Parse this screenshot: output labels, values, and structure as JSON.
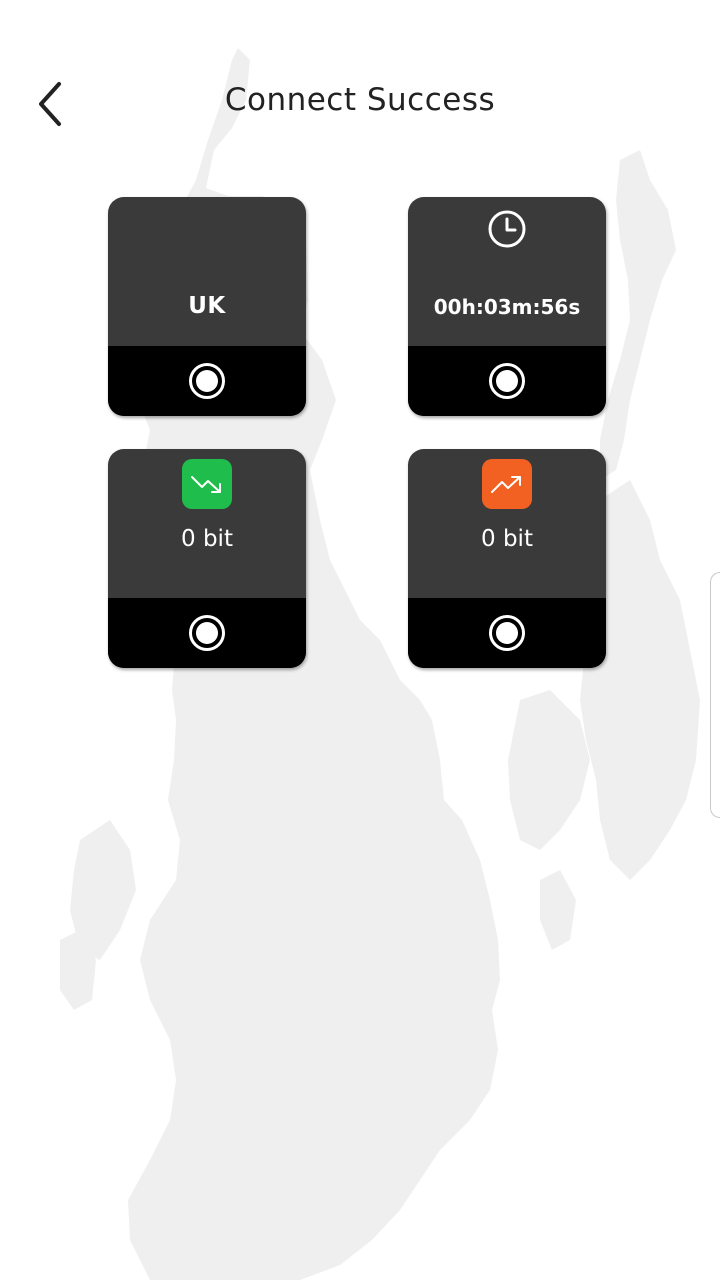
{
  "header": {
    "title": "Connect Success",
    "back_icon": "chevron-left-icon"
  },
  "cards": {
    "location": {
      "label": "UK"
    },
    "duration": {
      "icon": "clock-icon",
      "value": "00h:03m:56s"
    },
    "download": {
      "icon": "trend-down-icon",
      "icon_color": "#1fbd4c",
      "value": "0 bit"
    },
    "upload": {
      "icon": "trend-up-icon",
      "icon_color": "#f26122",
      "value": "0 bit"
    }
  },
  "colors": {
    "card_top": "#3a3a3a",
    "card_bottom": "#000000",
    "background": "#ffffff",
    "map": "#f0f0f0"
  }
}
